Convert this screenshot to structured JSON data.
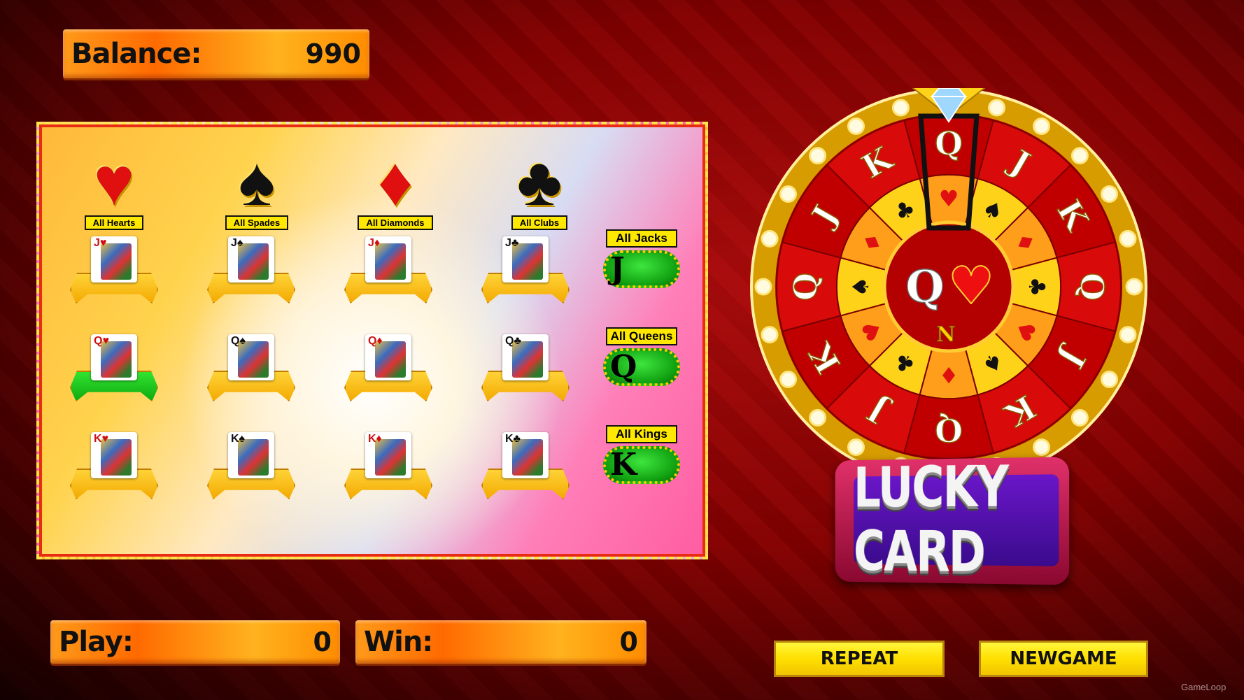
{
  "balance": {
    "label": "Balance:",
    "value": "990"
  },
  "play": {
    "label": "Play:",
    "value": "0"
  },
  "win": {
    "label": "Win:",
    "value": "0"
  },
  "suits": [
    {
      "label": "All Hearts",
      "glyph": "♥",
      "color": "#e01010"
    },
    {
      "label": "All Spades",
      "glyph": "♠",
      "color": "#111111"
    },
    {
      "label": "All Diamonds",
      "glyph": "♦",
      "color": "#e01010"
    },
    {
      "label": "All Clubs",
      "glyph": "♣",
      "color": "#111111"
    }
  ],
  "card_rows": [
    {
      "tag": "All Jacks",
      "chip": "J",
      "cards": [
        {
          "rank": "J",
          "suit": "♥"
        },
        {
          "rank": "J",
          "suit": "♠"
        },
        {
          "rank": "J",
          "suit": "♦"
        },
        {
          "rank": "J",
          "suit": "♣"
        }
      ]
    },
    {
      "tag": "All Queens",
      "chip": "Q",
      "cards": [
        {
          "rank": "Q",
          "suit": "♥",
          "selected": true
        },
        {
          "rank": "Q",
          "suit": "♠"
        },
        {
          "rank": "Q",
          "suit": "♦"
        },
        {
          "rank": "Q",
          "suit": "♣"
        }
      ]
    },
    {
      "tag": "All Kings",
      "chip": "K",
      "cards": [
        {
          "rank": "K",
          "suit": "♥"
        },
        {
          "rank": "K",
          "suit": "♠"
        },
        {
          "rank": "K",
          "suit": "♦"
        },
        {
          "rank": "K",
          "suit": "♣"
        }
      ]
    }
  ],
  "wheel": {
    "outer_ranks": [
      "Q",
      "J",
      "K",
      "Q",
      "J",
      "K",
      "Q",
      "J",
      "K",
      "Q",
      "J",
      "K"
    ],
    "inner_suits": [
      "♥",
      "♠",
      "♦",
      "♣",
      "♥",
      "♠",
      "♦",
      "♣",
      "♥",
      "♠",
      "♦",
      "♣"
    ],
    "center_rank": "Q",
    "center_suit": "♥",
    "center_mark": "N",
    "pointer_icon": "diamond-gem-icon"
  },
  "logo": {
    "text": "LUCKY CARD"
  },
  "buttons": {
    "repeat": "REPEAT",
    "newgame": "NEWGAME"
  },
  "watermark": "GameLoop"
}
